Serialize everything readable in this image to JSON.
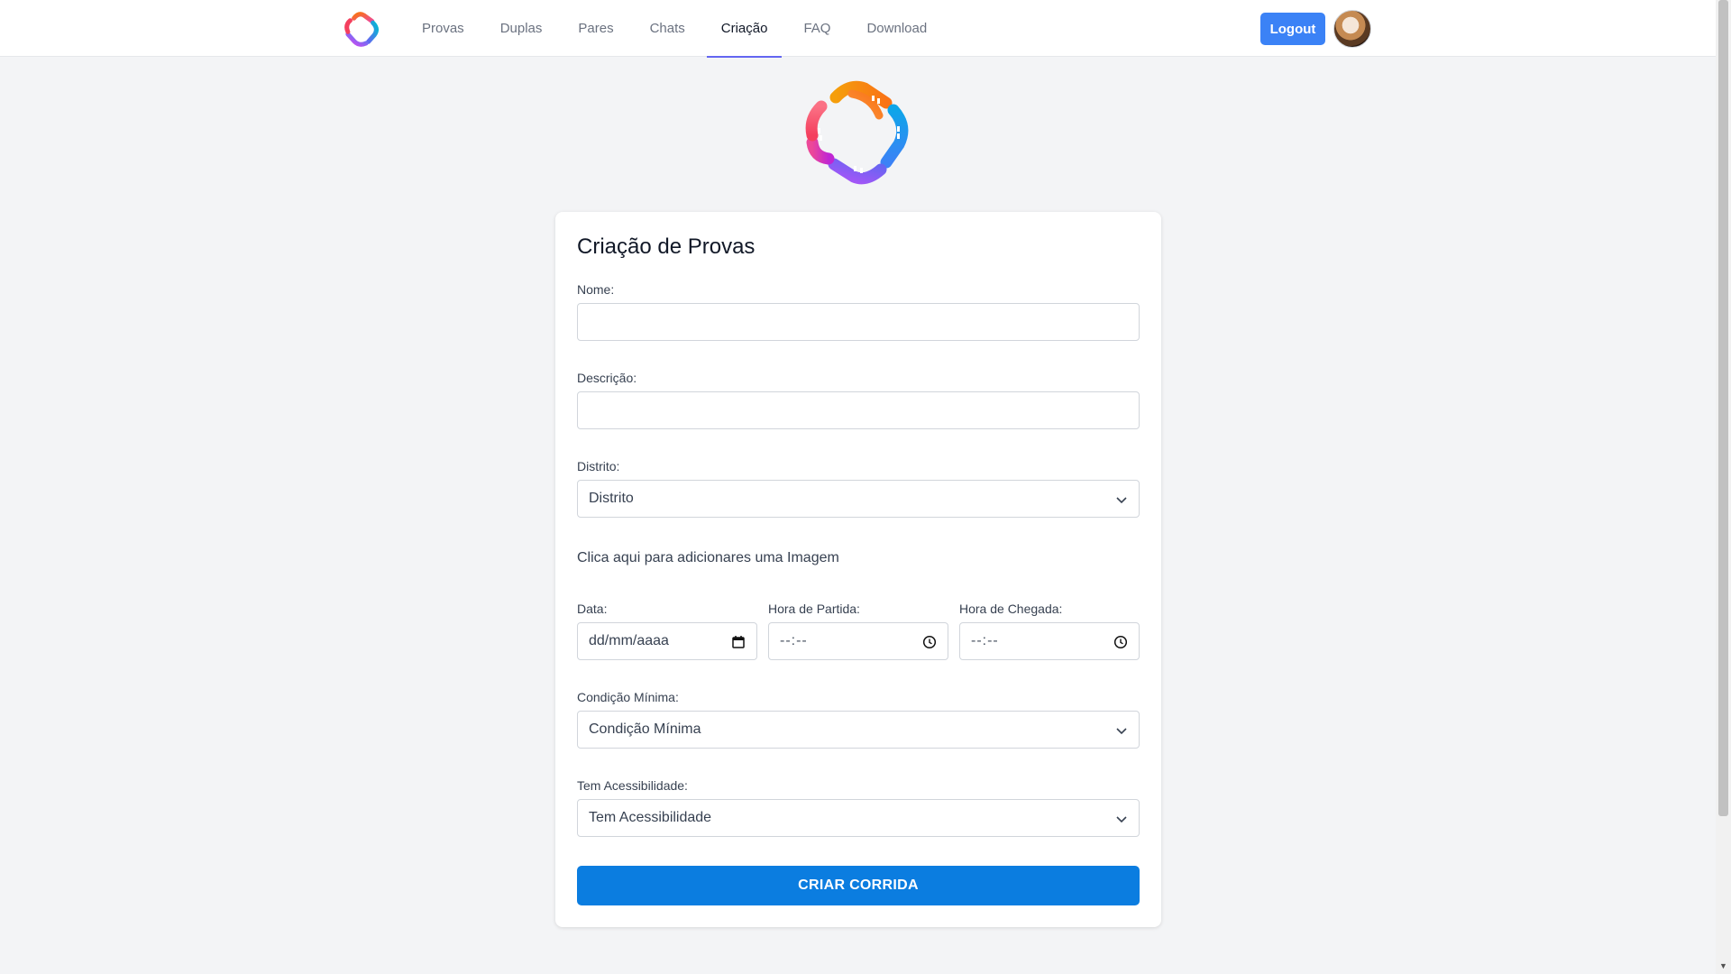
{
  "nav": {
    "links": [
      "Provas",
      "Duplas",
      "Pares",
      "Chats",
      "Criação",
      "FAQ",
      "Download"
    ],
    "active": "Criação",
    "logout_label": "Logout"
  },
  "form": {
    "title": "Criação de Provas",
    "nome_label": "Nome:",
    "descricao_label": "Descrição:",
    "distrito_label": "Distrito:",
    "distrito_value": "Distrito",
    "image_link": "Clica aqui para adicionares uma Imagem",
    "data_label": "Data:",
    "data_placeholder": "dd/mm/aaaa",
    "partida_label": "Hora de Partida:",
    "partida_placeholder": "--:--",
    "chegada_label": "Hora de Chegada:",
    "chegada_placeholder": "--:--",
    "condicao_label": "Condição Mínima:",
    "condicao_value": "Condição Mínima",
    "acessibilidade_label": "Tem Acessibilidade:",
    "acessibilidade_value": "Tem Acessibilidade",
    "submit_label": "CRIAR CORRIDA"
  },
  "colors": {
    "primary_button": "#0b7de0",
    "logout_button": "#3b82f6",
    "active_tab_underline": "#6366f1",
    "background": "#f3f4f6"
  },
  "icons": {
    "brand": "swirl-logo-icon",
    "select": "chevron-down-icon",
    "date": "calendar-icon",
    "time": "clock-icon"
  }
}
